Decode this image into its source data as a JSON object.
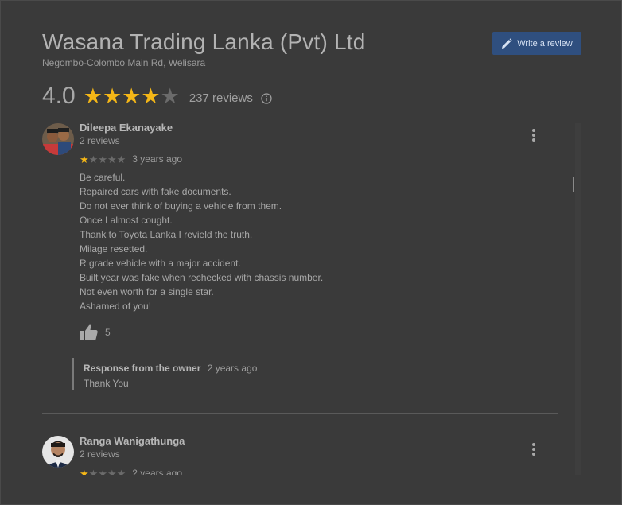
{
  "place": {
    "title": "Wasana Trading Lanka (Pvt) Ltd",
    "address": "Negombo-Colombo Main Rd, Welisara"
  },
  "actions": {
    "write_review_label": "Write a review"
  },
  "rating": {
    "value": "4.0",
    "stars_filled": 4,
    "stars_total": 5,
    "count_label": "237 reviews"
  },
  "colors": {
    "star_on": "#f5b717",
    "star_off": "#6b6b6b",
    "button": "#2f4f7f"
  },
  "reviews": [
    {
      "name": "Dileepa Ekanayake",
      "review_count": "2 reviews",
      "stars": 1,
      "time": "3 years ago",
      "lines": [
        "Be careful.",
        "Repaired cars with fake documents.",
        "Do not ever think of buying a vehicle from them.",
        "Once I almost cought.",
        "Thank to Toyota Lanka I revield the truth.",
        "Milage resetted.",
        "R grade vehicle with a major accident.",
        "Built year was fake when rechecked with chassis number.",
        "Not even worth for a single star.",
        "Ashamed of you!"
      ],
      "likes": "5",
      "owner_response": {
        "label": "Response from the owner",
        "time": "2 years ago",
        "text": "Thank You"
      }
    },
    {
      "name": "Ranga Wanigathunga",
      "review_count": "2 reviews",
      "stars": 1,
      "time": "2 years ago"
    }
  ]
}
